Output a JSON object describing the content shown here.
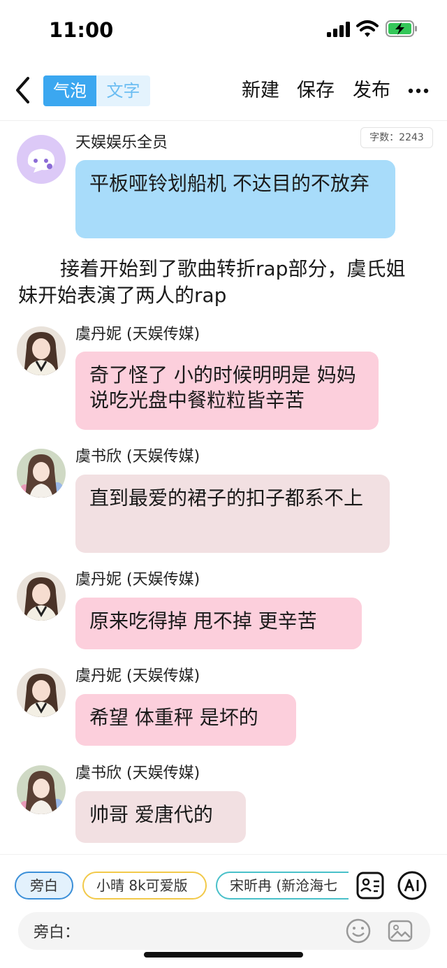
{
  "status_bar": {
    "time": "11:00",
    "icons": [
      "signal-icon",
      "wifi-icon",
      "battery-charging-icon"
    ]
  },
  "nav": {
    "back_icon": "chevron-left-icon",
    "tabs": [
      {
        "label": "气泡",
        "active": true
      },
      {
        "label": "文字",
        "active": false
      }
    ],
    "actions": [
      "新建",
      "保存",
      "发布"
    ],
    "more_icon": "ellipsis-icon"
  },
  "word_count": "字数：2243",
  "messages": [
    {
      "name": "天娱娱乐全员",
      "text": "平板哑铃划船机 不达目的不放弃",
      "style": "blue",
      "avatar": "ghost-logo"
    },
    {
      "name": "虞丹妮 (天娱传媒)",
      "text": "奇了怪了 小的时候明明是 妈妈说吃光盘中餐粒粒皆辛苦",
      "style": "pink",
      "avatar": "girl-photo-a"
    },
    {
      "name": "虞书欣 (天娱传媒)",
      "text": "直到最爱的裙子的扣子都系不上",
      "style": "rose",
      "avatar": "girl-photo-b"
    },
    {
      "name": "虞丹妮 (天娱传媒)",
      "text": "原来吃得掉 甩不掉 更辛苦",
      "style": "pink",
      "avatar": "girl-photo-a"
    },
    {
      "name": "虞丹妮 (天娱传媒)",
      "text": "希望 体重秤 是坏的",
      "style": "pink",
      "avatar": "girl-photo-a"
    },
    {
      "name": "虞书欣 (天娱传媒)",
      "text": "帅哥 爱唐代的",
      "style": "rose",
      "avatar": "girl-photo-b"
    }
  ],
  "narration": "接着开始到了歌曲转折rap部分，虞氏姐妹开始表演了两人的rap",
  "role_chips": [
    "旁白",
    "小晴 8k可爱版",
    "宋昕冉 (新沧海七"
  ],
  "tools": [
    "contact-card-icon",
    "ai-icon"
  ],
  "input": {
    "label": "旁白：",
    "icons": [
      "emoji-icon",
      "image-icon"
    ]
  },
  "colors": {
    "accent": "#3ba7f0",
    "bubble_blue": "#a8dcfa",
    "bubble_pink": "#fccfdc",
    "bubble_rose": "#f2e0e2"
  }
}
